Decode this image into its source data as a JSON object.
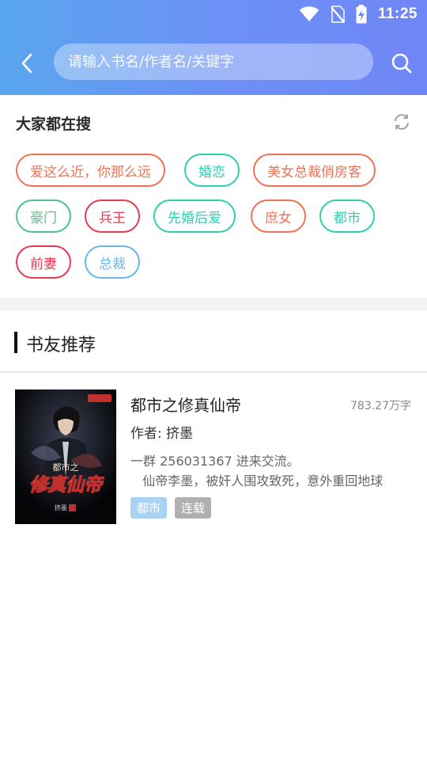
{
  "status_bar": {
    "time": "11:25",
    "icons": [
      "wifi-icon",
      "no-sim-icon",
      "battery-charging-icon"
    ]
  },
  "header": {
    "back_icon": "chevron-left-icon",
    "search_placeholder": "请输入书名/作者名/关键字",
    "search_icon": "search-icon"
  },
  "hot_search": {
    "title": "大家都在搜",
    "refresh_icon": "refresh-icon",
    "tags": [
      {
        "label": "爱这么近，你那么远",
        "color": "#f07256"
      },
      {
        "label": "婚恋",
        "color": "#2fcfb2"
      },
      {
        "label": "美女总裁俏房客",
        "color": "#f07256"
      },
      {
        "label": "豪门",
        "color": "#4fc28a"
      },
      {
        "label": "兵王",
        "color": "#e63b53"
      },
      {
        "label": "先婚后爱",
        "color": "#2fcfb2"
      },
      {
        "label": "庶女",
        "color": "#f07256"
      },
      {
        "label": "都市",
        "color": "#2fcfb2"
      },
      {
        "label": "前妻",
        "color": "#e63b53"
      },
      {
        "label": "总裁",
        "color": "#6ab6ec"
      }
    ]
  },
  "recommend": {
    "title": "书友推荐",
    "books": [
      {
        "title": "都市之修真仙帝",
        "word_count": "783.27万字",
        "author": "作者: 挤墨",
        "desc_line1": "一群 256031367  进来交流。",
        "desc_line2": "   仙帝李墨，被奸人围攻致死，意外重回地球",
        "badges": [
          {
            "label": "都市",
            "color": "#a8d3f3"
          },
          {
            "label": "连载",
            "color": "#b0b0b0"
          }
        ],
        "cover_title": "修真仙帝",
        "cover_subtitle": "都市之",
        "cover_author": "挤墨"
      }
    ]
  }
}
